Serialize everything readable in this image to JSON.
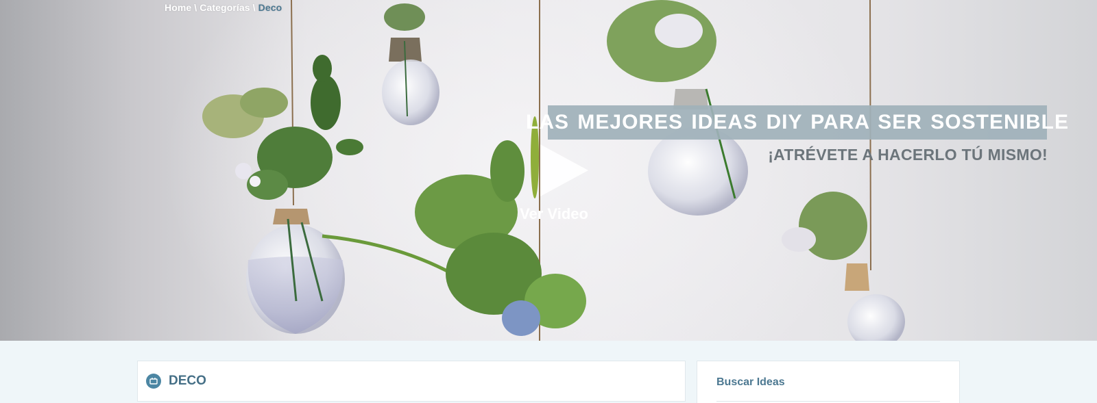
{
  "breadcrumb": {
    "home": "Home",
    "separator": "\\",
    "categories": "Categorías",
    "current": "Deco"
  },
  "hero": {
    "headline": "LAS MEJORES IDEAS DIY PARA SER SOSTENIBLE",
    "subheadline": "¡ATRÉVETE A HACERLO TÚ MISMO!",
    "video_label": "Ver Video",
    "play_icon": "play-icon"
  },
  "category_card": {
    "icon": "category-icon",
    "title": "DECO"
  },
  "sidebar": {
    "search_title": "Buscar Ideas"
  },
  "colors": {
    "accent": "#4c7891",
    "headline_bg": "#a0b1ba",
    "page_bg": "#eff6f9"
  }
}
